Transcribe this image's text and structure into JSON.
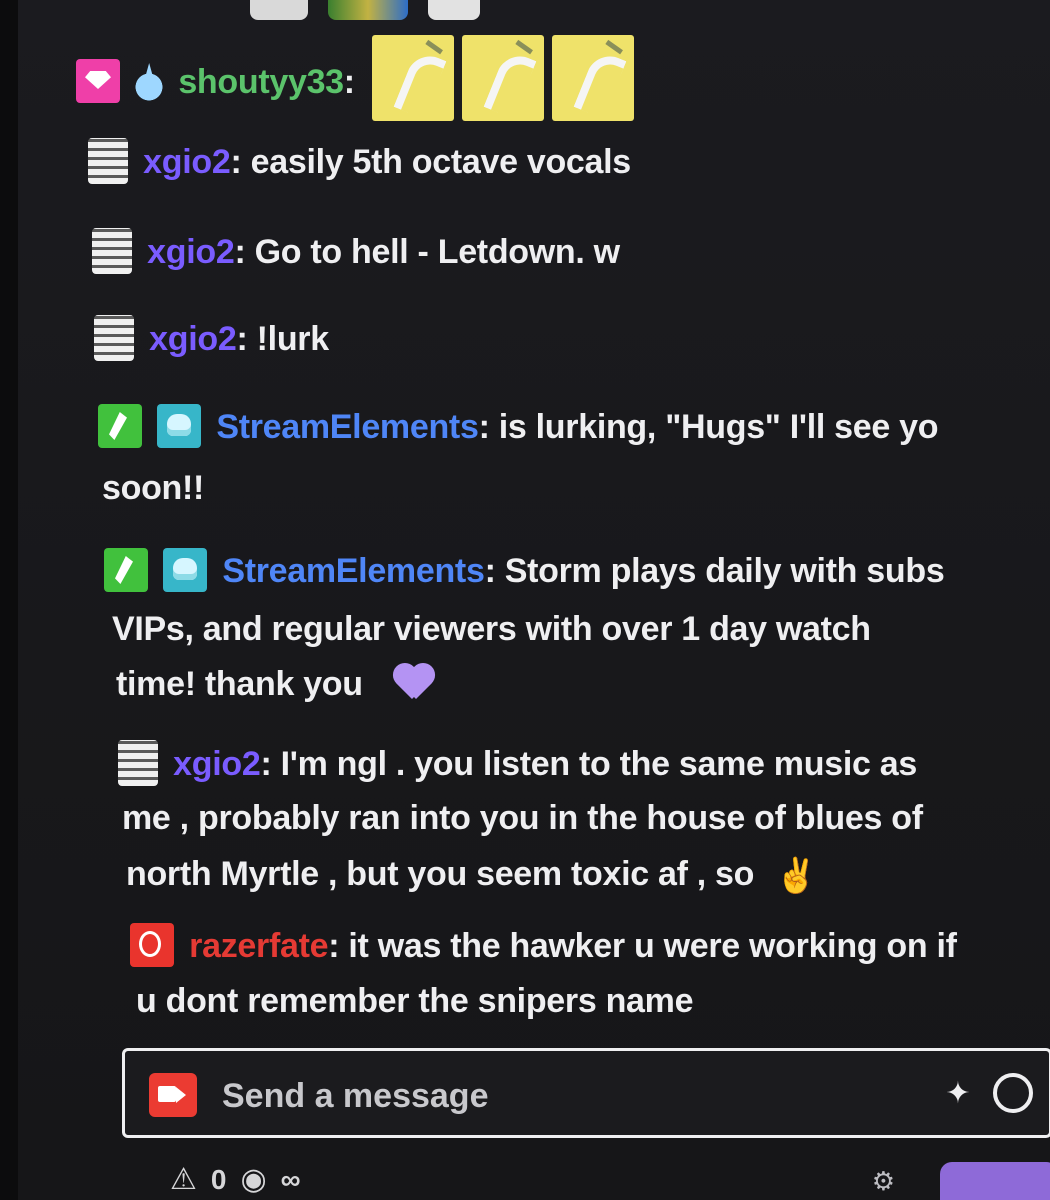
{
  "colors": {
    "background": "#18181b",
    "text": "#efeff1",
    "purple_user": "#7a5cff",
    "green_user": "#5bc36b",
    "blue_user": "#4f86f7",
    "red_user": "#e53a34",
    "send_bar_border": "#efeff1",
    "bottom_button": "#8e6ad8"
  },
  "chat": {
    "messages": [
      {
        "username": "shoutyy33",
        "separator": ":",
        "text": "",
        "username_color": "#5bc36b",
        "badges": [
          "gem-badge",
          "water-drop-badge"
        ],
        "emotes": [
          "yellow-emote",
          "yellow-emote",
          "yellow-emote"
        ]
      },
      {
        "username": "xgio2",
        "separator": ":",
        "text": " easily 5th octave vocals",
        "username_color": "#7a5cff",
        "badges": [
          "tile-badge"
        ]
      },
      {
        "username": "xgio2",
        "separator": ":",
        "text": " Go to hell - Letdown. w",
        "username_color": "#7a5cff",
        "badges": [
          "tile-badge"
        ]
      },
      {
        "username": "xgio2",
        "separator": ":",
        "text": " !lurk",
        "username_color": "#7a5cff",
        "badges": [
          "tile-badge"
        ]
      },
      {
        "username": "StreamElements",
        "separator": ":",
        "text": " is lurking, \"Hugs\" I'll see yo",
        "continuation": "soon!!",
        "username_color": "#4f86f7",
        "badges": [
          "moderator-badge",
          "bot-badge"
        ]
      },
      {
        "username": "StreamElements",
        "separator": ":",
        "text": " Storm plays daily with subs",
        "line2": "VIPs, and regular viewers with over 1 day watch",
        "line3": "time! thank you",
        "username_color": "#4f86f7",
        "badges": [
          "moderator-badge",
          "bot-badge"
        ],
        "trailing_emote": "heart-emote"
      },
      {
        "username": "xgio2",
        "separator": ":",
        "text": " I'm ngl . you listen to the same music as",
        "line2": "me , probably ran into you in the house of blues of",
        "line3": "north Myrtle , but you seem toxic af , so",
        "username_color": "#7a5cff",
        "badges": [
          "tile-badge"
        ],
        "trailing_emote": "victory-hand-emoji"
      },
      {
        "username": "razerfate",
        "separator": ":",
        "text": " it was the hawker u were working on if",
        "line2": "u dont remember the snipers name",
        "username_color": "#e53a34",
        "badges": [
          "razer-badge"
        ]
      }
    ]
  },
  "composer": {
    "placeholder": "Send a message",
    "left_icon": "camera-icon",
    "right_icons": [
      "party-icon",
      "emoji-icon"
    ]
  },
  "bottom_bar": {
    "left_icons": [
      "alert-icon",
      "points-icon"
    ],
    "values": [
      "0",
      "∞"
    ]
  }
}
